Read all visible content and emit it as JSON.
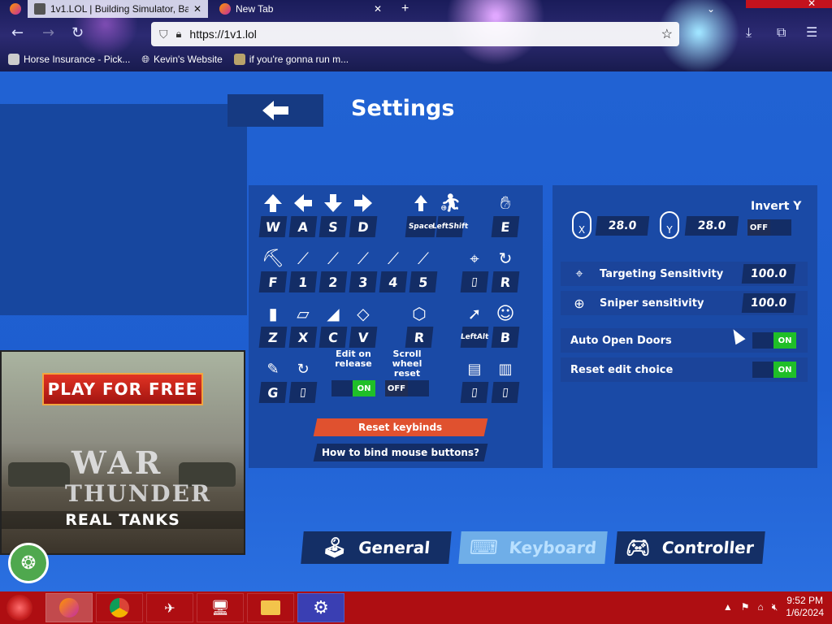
{
  "browser": {
    "tabs": [
      {
        "label": "1v1.LOL | Building Simulator, Ba...",
        "active": true
      },
      {
        "label": "New Tab",
        "active": false
      }
    ],
    "url": "https://1v1.lol",
    "bookmarks": [
      "Horse Insurance - Pick...",
      "Kevin's Website",
      "if you're gonna run m..."
    ]
  },
  "settings": {
    "title": "Settings",
    "keybinds": {
      "movement": [
        "W",
        "A",
        "S",
        "D"
      ],
      "jump": "Space",
      "crouch_line1": "Left",
      "crouch_line2": "Shift",
      "use": "E",
      "slots": [
        "F",
        "1",
        "2",
        "3",
        "4",
        "5"
      ],
      "aim_key": "",
      "reload": "R",
      "builds": [
        "Z",
        "X",
        "C",
        "V"
      ],
      "edit": "R",
      "alt_line1": "Left",
      "alt_line2": "Alt",
      "emote": "B",
      "edit_key": "G",
      "edit_on_release_label": "Edit on release",
      "edit_on_release_value": "ON",
      "scroll_reset_label": "Scroll wheel reset",
      "scroll_reset_value": "OFF",
      "reset_button": "Reset keybinds",
      "help_button": "How to bind mouse buttons?"
    },
    "sensitivity": {
      "invert_label": "Invert Y",
      "invert_value": "OFF",
      "x_axis_label": "X",
      "y_axis_label": "Y",
      "x_value": "28.0",
      "y_value": "28.0",
      "targeting_label": "Targeting Sensitivity",
      "targeting_value": "100.0",
      "sniper_label": "Sniper sensitivity",
      "sniper_value": "100.0",
      "auto_doors_label": "Auto Open Doors",
      "auto_doors_value": "ON",
      "reset_edit_label": "Reset edit choice",
      "reset_edit_value": "ON"
    },
    "tabs": {
      "general": "General",
      "keyboard": "Keyboard",
      "controller": "Controller",
      "active": "Keyboard"
    }
  },
  "ad": {
    "cta": "PLAY FOR FREE",
    "logo_line1": "WAR",
    "logo_line2": "THUNDER",
    "subtitle": "REAL TANKS"
  },
  "taskbar": {
    "time": "9:52 PM",
    "date": "1/6/2024"
  },
  "colors": {
    "accent_orange": "#e0512f",
    "toggle_on": "#1fbf28",
    "page_blue": "#1f5fcf",
    "taskbar_red": "#ae0e12"
  }
}
